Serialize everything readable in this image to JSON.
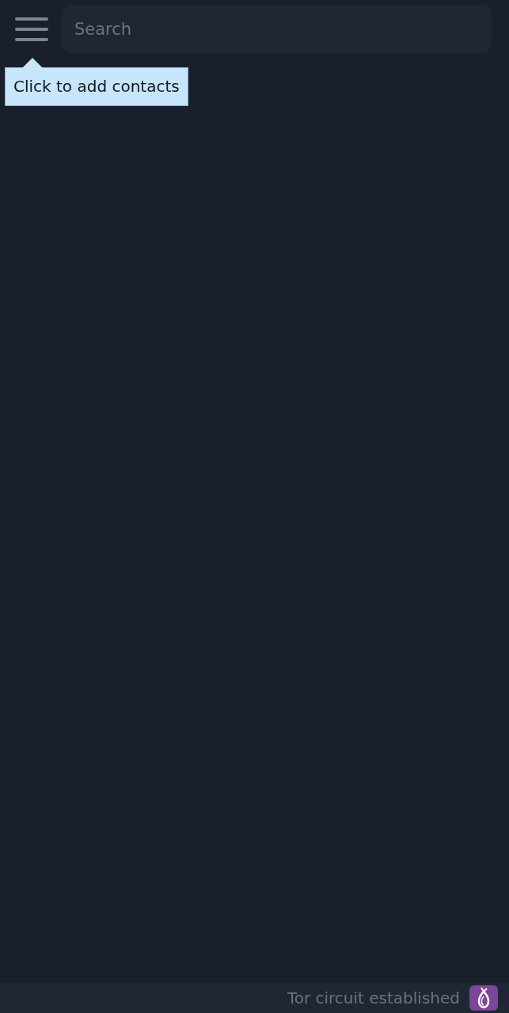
{
  "search": {
    "placeholder": "Search"
  },
  "tooltip": {
    "text": "Click to add contacts"
  },
  "status_bar": {
    "text": "Tor circuit established"
  }
}
